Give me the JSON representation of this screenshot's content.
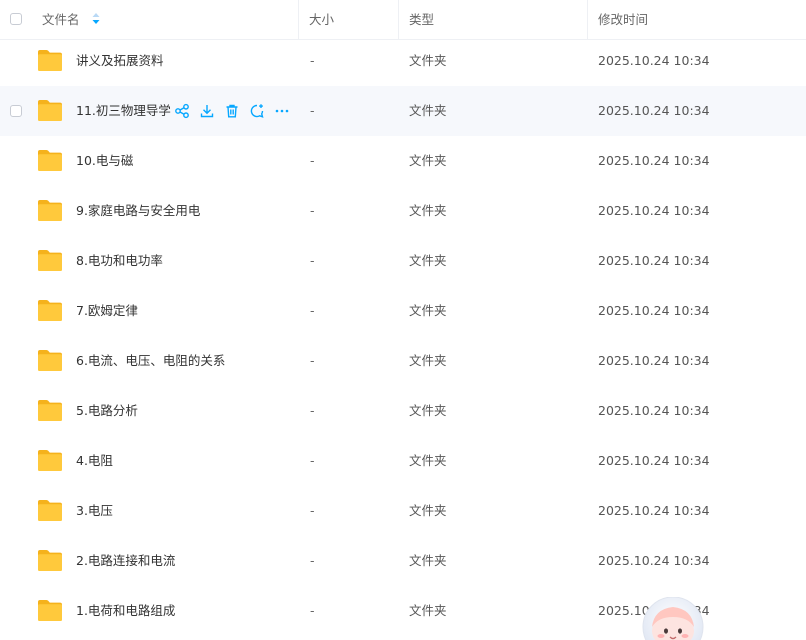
{
  "header": {
    "name_label": "文件名",
    "size_label": "大小",
    "type_label": "类型",
    "mtime_label": "修改时间"
  },
  "colors": {
    "accent": "#06a7ff",
    "folder": "#ffc93c",
    "folder_tab": "#f5b21c",
    "hover_row": "#f6f8fc"
  },
  "hovered_row_index": 1,
  "row_actions": [
    "share-icon",
    "download-icon",
    "delete-icon",
    "comment-icon",
    "more-icon"
  ],
  "files": [
    {
      "name": "讲义及拓展资料",
      "size": "-",
      "type": "文件夹",
      "mtime": "2025.10.24 10:34"
    },
    {
      "name": "11.初三物理导学",
      "size": "-",
      "type": "文件夹",
      "mtime": "2025.10.24 10:34"
    },
    {
      "name": "10.电与磁",
      "size": "-",
      "type": "文件夹",
      "mtime": "2025.10.24 10:34"
    },
    {
      "name": "9.家庭电路与安全用电",
      "size": "-",
      "type": "文件夹",
      "mtime": "2025.10.24 10:34"
    },
    {
      "name": "8.电功和电功率",
      "size": "-",
      "type": "文件夹",
      "mtime": "2025.10.24 10:34"
    },
    {
      "name": "7.欧姆定律",
      "size": "-",
      "type": "文件夹",
      "mtime": "2025.10.24 10:34"
    },
    {
      "name": "6.电流、电压、电阻的关系",
      "size": "-",
      "type": "文件夹",
      "mtime": "2025.10.24 10:34"
    },
    {
      "name": "5.电路分析",
      "size": "-",
      "type": "文件夹",
      "mtime": "2025.10.24 10:34"
    },
    {
      "name": "4.电阻",
      "size": "-",
      "type": "文件夹",
      "mtime": "2025.10.24 10:34"
    },
    {
      "name": "3.电压",
      "size": "-",
      "type": "文件夹",
      "mtime": "2025.10.24 10:34"
    },
    {
      "name": "2.电路连接和电流",
      "size": "-",
      "type": "文件夹",
      "mtime": "2025.10.24 10:34"
    },
    {
      "name": "1.电荷和电路组成",
      "size": "-",
      "type": "文件夹",
      "mtime": "2025.10.24 10:34"
    }
  ]
}
